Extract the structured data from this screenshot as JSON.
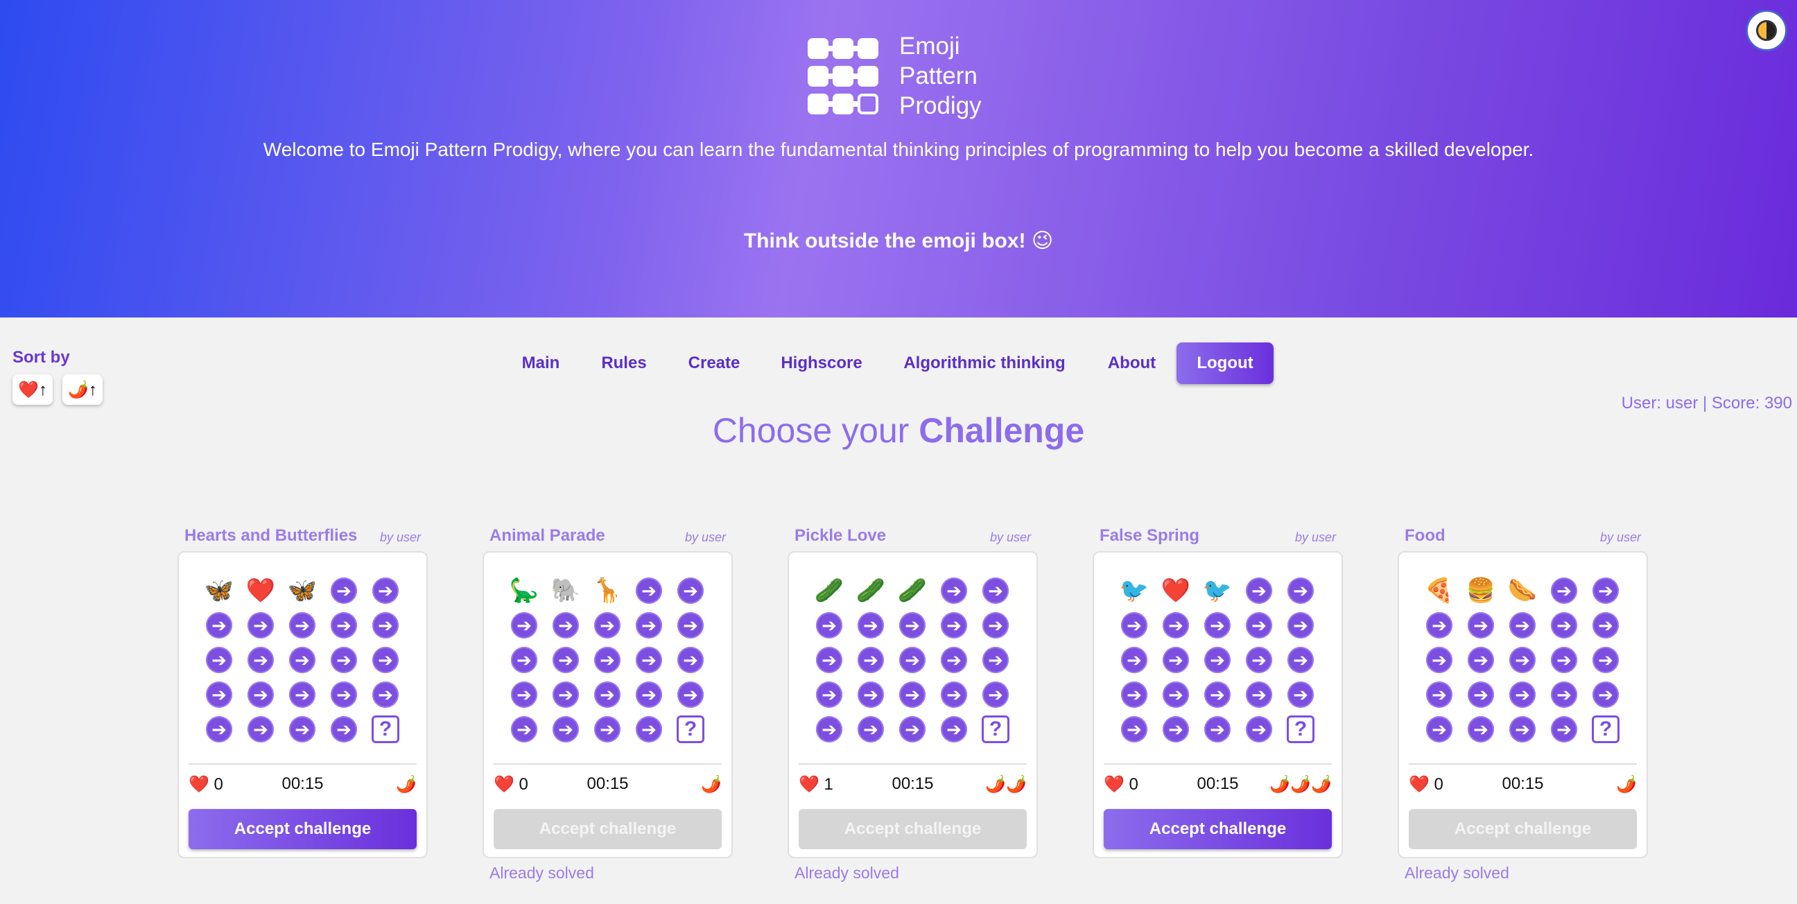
{
  "header": {
    "logo_line1": "Emoji",
    "logo_line2": "Pattern",
    "logo_line3": "Prodigy",
    "welcome": "Welcome to Emoji Pattern Prodigy, where you can learn the fundamental thinking principles of programming to help you become a skilled developer.",
    "tagline": "Think outside the emoji box! 😉"
  },
  "sort": {
    "label": "Sort by",
    "by_likes": "❤️↑",
    "by_difficulty": "🌶️↑"
  },
  "nav": {
    "main": "Main",
    "rules": "Rules",
    "create": "Create",
    "highscore": "Highscore",
    "algorithmic": "Algorithmic thinking",
    "about": "About",
    "logout": "Logout"
  },
  "user_info": "User: user | Score: 390",
  "page_title": {
    "prefix": "Choose your ",
    "emphasis": "Challenge"
  },
  "challenges": [
    {
      "title": "Hearts and Butterflies",
      "author": "by user",
      "seq": [
        "🦋",
        "❤️",
        "🦋"
      ],
      "likes": "❤️ 0",
      "time": "00:15",
      "spice": "🌶️",
      "button": "Accept challenge",
      "solved": ""
    },
    {
      "title": "Animal Parade",
      "author": "by user",
      "seq": [
        "🦕",
        "🐘",
        "🦒"
      ],
      "likes": "❤️ 0",
      "time": "00:15",
      "spice": "🌶️",
      "button": "Accept challenge",
      "solved": "Already solved"
    },
    {
      "title": "Pickle Love",
      "author": "by user",
      "seq": [
        "🥒",
        "🥒",
        "🥒"
      ],
      "likes": "❤️ 1",
      "time": "00:15",
      "spice": "🌶️🌶️",
      "button": "Accept challenge",
      "solved": "Already solved"
    },
    {
      "title": "False Spring",
      "author": "by user",
      "seq": [
        "🐦",
        "❤️",
        "🐦"
      ],
      "likes": "❤️ 0",
      "time": "00:15",
      "spice": "🌶️🌶️🌶️",
      "button": "Accept challenge",
      "solved": ""
    },
    {
      "title": "Food",
      "author": "by user",
      "seq": [
        "🍕",
        "🍔",
        "🌭"
      ],
      "likes": "❤️ 0",
      "time": "00:15",
      "spice": "🌶️",
      "button": "Accept challenge",
      "solved": "Already solved"
    }
  ],
  "grid_arrow": "➔",
  "grid_unknown": "?"
}
